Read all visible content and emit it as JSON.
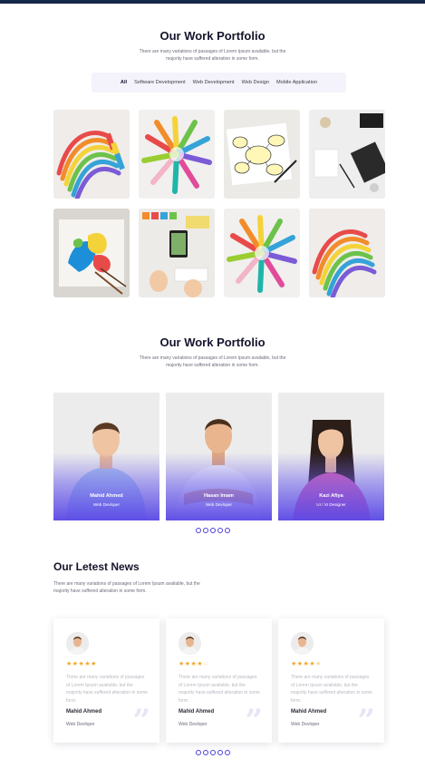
{
  "portfolio": {
    "title": "Our Work Portfolio",
    "description": "There are many variations of passages of Lorem Ipsum available, but the majority have suffered alteration in some form.",
    "filters": [
      {
        "label": "All",
        "active": true
      },
      {
        "label": "Software Development",
        "active": false
      },
      {
        "label": "Web Development",
        "active": false
      },
      {
        "label": "Web Design",
        "active": false
      },
      {
        "label": "Mobile Application",
        "active": false
      }
    ],
    "items": [
      "rainbow-crayons-image",
      "colorful-markers-image",
      "sketch-notes-image",
      "desk-workspace-image",
      "paint-canvas-image",
      "design-workspace-image",
      "colorful-markers-image",
      "rainbow-crayons-image"
    ]
  },
  "team": {
    "title": "Our Work Portfolio",
    "description": "There are many variations of passages of Lorem Ipsum available, but the majority have suffered alteration in some form.",
    "members": [
      {
        "name": "Mahid Ahmed",
        "role": "Web Devloper"
      },
      {
        "name": "Hasan Imam",
        "role": "Web Devloper"
      },
      {
        "name": "Kazi Afiya",
        "role": "UI / XI Designer"
      }
    ],
    "dots": 5
  },
  "news": {
    "title": "Our Letest News",
    "description": "There are many variations of passages of Lorem Ipsum available, but the majority have suffered alteration in some form.",
    "cards": [
      {
        "rating": 5,
        "text": "There are many variations of passages of Lorem Ipsum available, but the majority have suffered alteration in some form.",
        "name": "Mahid Ahmed",
        "role": "Web Devloper"
      },
      {
        "rating": 4,
        "text": "There are many variations of passages of Lorem Ipsum available, but the majority have suffered alteration in some form.",
        "name": "Mahid Ahmed",
        "role": "Web Devloper"
      },
      {
        "rating": 4.5,
        "text": "There are many variations of passages of Lorem Ipsum available, but the majority have suffered alteration in some form.",
        "name": "Mahid Ahmed",
        "role": "Web Devloper"
      }
    ],
    "dots": 5
  },
  "colors": {
    "accent": "#4b3fd8",
    "topbar": "#16284a",
    "star": "#f5a623"
  }
}
